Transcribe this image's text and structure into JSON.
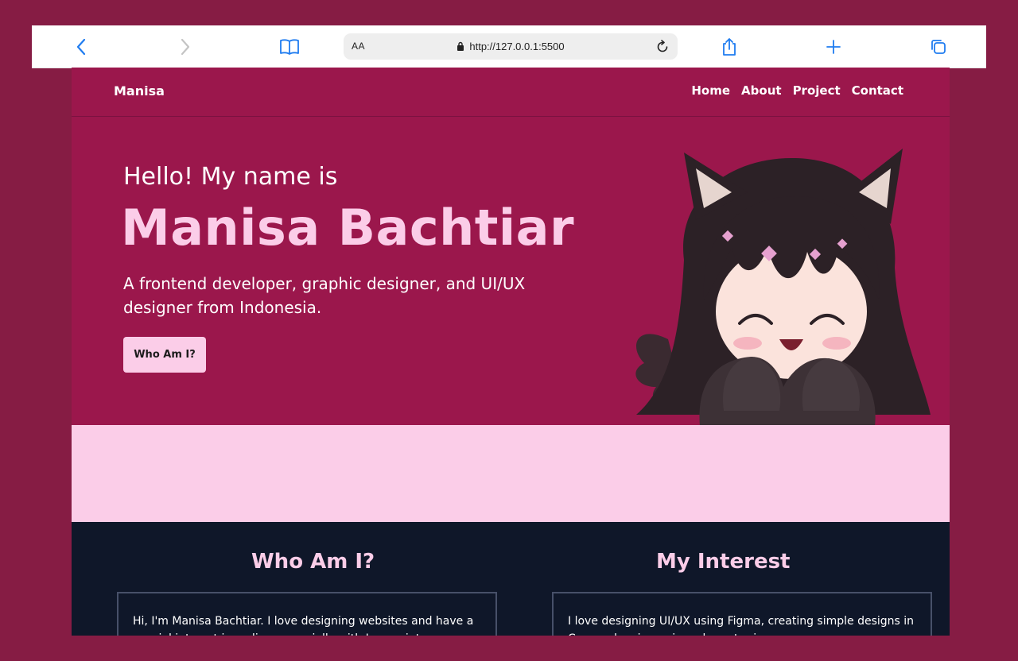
{
  "browser": {
    "aa_label": "AA",
    "url": "http://127.0.0.1:5500",
    "colors": {
      "accent": "#1f7cf0",
      "disabled": "#c4c4c4"
    }
  },
  "nav": {
    "brand": "Manisa",
    "links": [
      "Home",
      "About",
      "Project",
      "Contact"
    ]
  },
  "hero": {
    "greeting": "Hello! My name is",
    "name": "Manisa Bachtiar",
    "description": "A frontend developer, graphic designer, and UI/UX designer from Indonesia.",
    "button_label": "Who Am I?"
  },
  "sections": {
    "who": {
      "title": "Who Am I?",
      "text": "Hi, I'm Manisa Bachtiar. I love designing websites and have a special interest in coding, especially with Javascript."
    },
    "interest": {
      "title": "My Interest",
      "text": "I love designing UI/UX using Figma, creating simple designs in Canva, drawing anime character in"
    }
  },
  "colors": {
    "background": "#861c44",
    "primary": "#9b174c",
    "pink": "#fbcde8",
    "dark": "#0f1729"
  }
}
